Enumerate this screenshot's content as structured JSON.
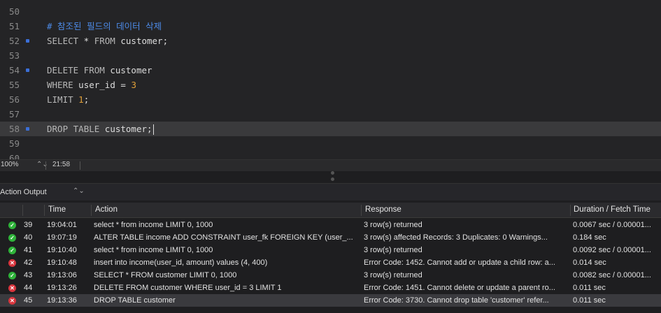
{
  "editor": {
    "lines": [
      {
        "n": "50",
        "marker": false,
        "current": false,
        "parts": []
      },
      {
        "n": "51",
        "marker": false,
        "current": false,
        "parts": [
          {
            "t": "# 참조된 필드의 데이터 삭제",
            "c": "cm"
          }
        ]
      },
      {
        "n": "52",
        "marker": true,
        "current": false,
        "parts": [
          {
            "t": "SELECT",
            "c": "kw"
          },
          {
            "t": " * ",
            "c": ""
          },
          {
            "t": "FROM",
            "c": "kw"
          },
          {
            "t": " customer;",
            "c": ""
          }
        ]
      },
      {
        "n": "53",
        "marker": false,
        "current": false,
        "parts": []
      },
      {
        "n": "54",
        "marker": true,
        "current": false,
        "parts": [
          {
            "t": "DELETE",
            "c": "kw"
          },
          {
            "t": " ",
            "c": ""
          },
          {
            "t": "FROM",
            "c": "kw"
          },
          {
            "t": " customer",
            "c": ""
          }
        ]
      },
      {
        "n": "55",
        "marker": false,
        "current": false,
        "parts": [
          {
            "t": "WHERE",
            "c": "kw"
          },
          {
            "t": " user_id = ",
            "c": ""
          },
          {
            "t": "3",
            "c": "num"
          }
        ]
      },
      {
        "n": "56",
        "marker": false,
        "current": false,
        "parts": [
          {
            "t": "LIMIT",
            "c": "kw"
          },
          {
            "t": " ",
            "c": ""
          },
          {
            "t": "1",
            "c": "num"
          },
          {
            "t": ";",
            "c": ""
          }
        ]
      },
      {
        "n": "57",
        "marker": false,
        "current": false,
        "parts": []
      },
      {
        "n": "58",
        "marker": true,
        "current": true,
        "parts": [
          {
            "t": "DROP",
            "c": "kw"
          },
          {
            "t": " ",
            "c": ""
          },
          {
            "t": "TABLE",
            "c": "kw"
          },
          {
            "t": " customer;",
            "c": ""
          }
        ]
      },
      {
        "n": "59",
        "marker": false,
        "current": false,
        "parts": []
      },
      {
        "n": "60",
        "marker": false,
        "current": false,
        "parts": []
      }
    ]
  },
  "statusbar": {
    "zoom": "100%",
    "zoom_stepper": "⌃⌄",
    "position": "21:58"
  },
  "output_panel": {
    "title": "Action Output",
    "selector": "⌃⌄"
  },
  "table": {
    "headers": {
      "time": "Time",
      "action": "Action",
      "response": "Response",
      "duration": "Duration / Fetch Time"
    },
    "rows": [
      {
        "status": "ok",
        "num": "39",
        "time": "19:04:01",
        "action": "select * from income LIMIT 0, 1000",
        "response": "3 row(s) returned",
        "duration": "0.0067 sec / 0.00001..."
      },
      {
        "status": "ok",
        "num": "40",
        "time": "19:07:19",
        "action": "ALTER TABLE income ADD CONSTRAINT user_fk FOREIGN KEY (user_...",
        "response": "3 row(s) affected Records: 3  Duplicates: 0  Warnings...",
        "duration": "0.184 sec"
      },
      {
        "status": "ok",
        "num": "41",
        "time": "19:10:40",
        "action": "select * from income LIMIT 0, 1000",
        "response": "3 row(s) returned",
        "duration": "0.0092 sec / 0.00001..."
      },
      {
        "status": "err",
        "num": "42",
        "time": "19:10:48",
        "action": "insert into income(user_id, amount) values (4, 400)",
        "response": "Error Code: 1452. Cannot add or update a child row: a...",
        "duration": "0.014 sec"
      },
      {
        "status": "ok",
        "num": "43",
        "time": "19:13:06",
        "action": "SELECT * FROM customer LIMIT 0, 1000",
        "response": "3 row(s) returned",
        "duration": "0.0082 sec / 0.00001..."
      },
      {
        "status": "err",
        "num": "44",
        "time": "19:13:26",
        "action": "DELETE FROM customer WHERE user_id = 3 LIMIT 1",
        "response": "Error Code: 1451. Cannot delete or update a parent ro...",
        "duration": "0.011 sec"
      },
      {
        "status": "err",
        "num": "45",
        "time": "19:13:36",
        "action": "DROP TABLE customer",
        "response": "Error Code: 3730. Cannot drop table 'customer' refer...",
        "duration": "0.011 sec"
      }
    ]
  }
}
